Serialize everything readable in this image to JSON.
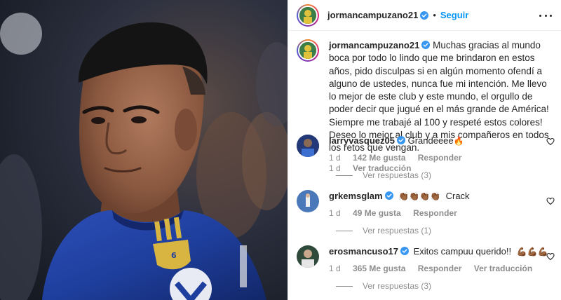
{
  "post": {
    "author": "jormancampuzano21",
    "follow_label": "Seguir",
    "separator": "•"
  },
  "caption": {
    "author": "jormancampuzano21",
    "text": "Muchas gracias al mundo boca por todo lo lindo que me brindaron en estos años, pido disculpas si en algún momento ofendí a alguno de ustedes, nunca fue mi intención. Me llevo lo mejor de este club y este mundo, el orgullo de poder decir que jugué en el más grande de América! Siempre me trabajé al 100 y respeté estos colores! Deseo lo mejor al club y a mis compañeros en todos los retos que vengan.",
    "time": "1 d",
    "translate": "Ver traducción"
  },
  "comments": [
    {
      "user": "larryvasquez05",
      "text": "Grandeeee",
      "emoji": "🔥",
      "time": "1 d",
      "likes": "142 Me gusta",
      "reply": "Responder",
      "translate": "",
      "view_replies": "Ver respuestas (3)"
    },
    {
      "user": "grkemsglam",
      "text": "Crack",
      "emoji": "👏🏾👏🏾👏🏾👏🏾",
      "time": "1 d",
      "likes": "49 Me gusta",
      "reply": "Responder",
      "translate": "",
      "view_replies": "Ver respuestas (1)"
    },
    {
      "user": "erosmancuso17",
      "text": "Exitos campuu querido!!",
      "emoji": "💪🏾💪🏾💪🏾",
      "time": "1 d",
      "likes": "365 Me gusta",
      "reply": "Responder",
      "translate": "Ver traducción",
      "view_replies": "Ver respuestas (3)"
    }
  ],
  "colors": {
    "link_blue": "#0095f6",
    "verified_blue": "#3897f0",
    "text": "#262626",
    "muted": "#8e8e8e",
    "jersey_blue": "#1f3f9e",
    "jersey_gold": "#d8b441"
  },
  "icons": {
    "verified": "verified-badge-icon",
    "more": "more-options-icon",
    "like": "heart-icon"
  }
}
